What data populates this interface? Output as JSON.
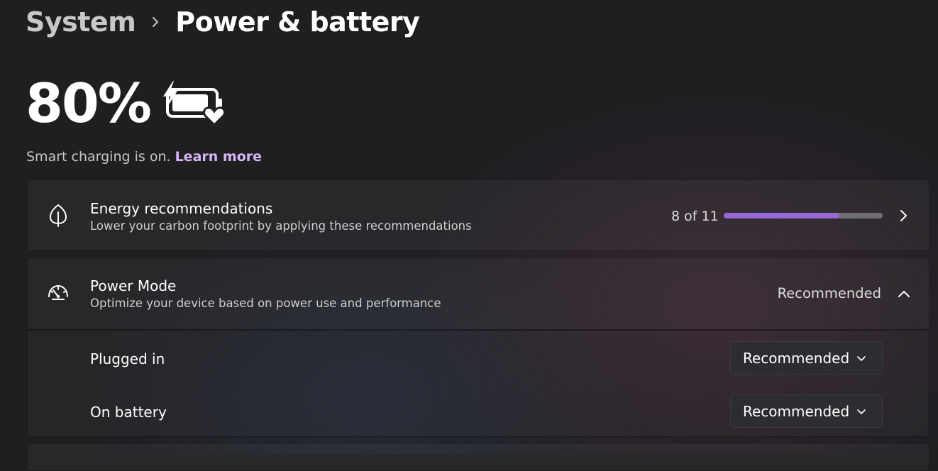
{
  "breadcrumb": {
    "parent": "System",
    "current": "Power & battery"
  },
  "battery": {
    "percent_text": "80%",
    "icon": "battery-charging-heart-icon",
    "smart_charging_text": "Smart charging is on.",
    "learn_more": "Learn more"
  },
  "energy": {
    "icon": "leaf-icon",
    "title": "Energy recommendations",
    "subtitle": "Lower your carbon footprint by applying these recommendations",
    "progress_text": "8 of 11",
    "progress_fraction": 0.727,
    "chevron": "chevron-right-icon"
  },
  "power_mode": {
    "icon": "speedometer-icon",
    "title": "Power Mode",
    "subtitle": "Optimize your device based on power use and performance",
    "value": "Recommended",
    "chevron": "chevron-up-icon",
    "plugged_in": {
      "label": "Plugged in",
      "value": "Recommended"
    },
    "on_battery": {
      "label": "On battery",
      "value": "Recommended"
    }
  },
  "colors": {
    "accent": "#9568d6",
    "link": "#d8b6f5",
    "background": "#1f1f22",
    "progress_track": "#6e6e73"
  }
}
